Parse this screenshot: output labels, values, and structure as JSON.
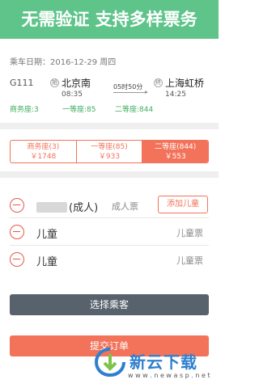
{
  "banner": {
    "text": "无需验证  支持多样票务"
  },
  "date": {
    "label": "乘车日期：2016-12-29 周四"
  },
  "train": {
    "number": "G111",
    "from": {
      "badge": "始",
      "name": "北京南",
      "time": "08:35"
    },
    "to": {
      "badge": "终",
      "name": "上海虹桥",
      "time": "14:25"
    },
    "duration": "05时50分",
    "seats": [
      {
        "label": "商务座:3"
      },
      {
        "label": "一等座:85"
      },
      {
        "label": "二等座:844"
      }
    ]
  },
  "seat_tabs": [
    {
      "name": "商务座(3)",
      "price": "￥1748",
      "active": false
    },
    {
      "name": "一等座(85)",
      "price": "￥933",
      "active": false
    },
    {
      "name": "二等座(844)",
      "price": "￥553",
      "active": true
    }
  ],
  "passengers": [
    {
      "name": "(成人)",
      "type": "成人票",
      "add_child": "添加儿童"
    },
    {
      "name": "儿童",
      "type": "儿童票"
    },
    {
      "name": "儿童",
      "type": "儿童票"
    }
  ],
  "buttons": {
    "select": "选择乘客",
    "submit": "提交订单"
  },
  "watermark": {
    "title": "新云下载",
    "url": "w w w . n e w a s p . n e t"
  },
  "colors": {
    "banner": "#5ec48a",
    "accent": "#f2735a",
    "dark_button": "#58626c",
    "seat_stat": "#3fae5f"
  }
}
